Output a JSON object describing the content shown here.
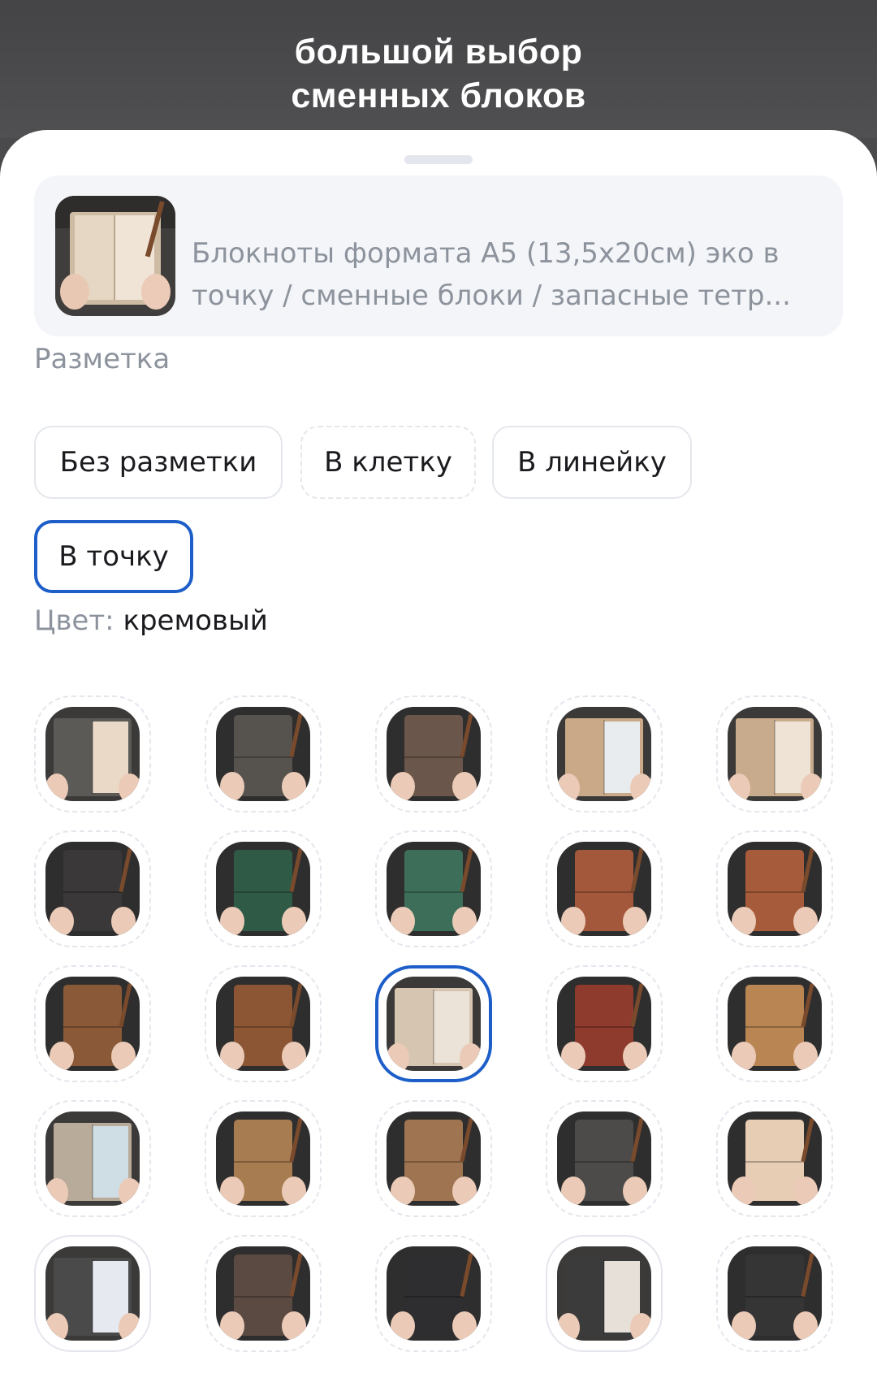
{
  "banner": {
    "line1": "большой выбор",
    "line2": "сменных блоков"
  },
  "product": {
    "title": "Блокноты формата А5 (13,5х20см) эко в точку / сменные блоки / запасные тетр..."
  },
  "markup": {
    "label": "Разметка",
    "options": [
      {
        "label": "Без разметки",
        "state": "available"
      },
      {
        "label": "В клетку",
        "state": "unavailable"
      },
      {
        "label": "В линейку",
        "state": "available"
      },
      {
        "label": "В точку",
        "state": "selected"
      }
    ]
  },
  "color": {
    "label": "Цвет:",
    "value": "кремовый",
    "swatches": [
      {
        "cover": "#5b5a57",
        "page": "#ead9c6",
        "style": "open",
        "border": "dashed"
      },
      {
        "cover": "#56534f",
        "page": null,
        "style": "closed",
        "border": "dashed"
      },
      {
        "cover": "#6a564a",
        "page": null,
        "style": "closed",
        "border": "dashed"
      },
      {
        "cover": "#c9a987",
        "page": "#e9ecef",
        "style": "open",
        "border": "dashed"
      },
      {
        "cover": "#c8aa8c",
        "page": "#efe3d6",
        "style": "open",
        "border": "dashed"
      },
      {
        "cover": "#3a3838",
        "page": null,
        "style": "closed",
        "border": "dashed"
      },
      {
        "cover": "#2f5a46",
        "page": null,
        "style": "closed",
        "border": "dashed"
      },
      {
        "cover": "#3d6e5a",
        "page": null,
        "style": "closed",
        "border": "dashed"
      },
      {
        "cover": "#a4583b",
        "page": null,
        "style": "closed",
        "border": "dashed"
      },
      {
        "cover": "#a65c3a",
        "page": null,
        "style": "closed",
        "border": "dashed"
      },
      {
        "cover": "#8a5a38",
        "page": null,
        "style": "closed",
        "border": "dashed"
      },
      {
        "cover": "#8c5634",
        "page": null,
        "style": "closed",
        "border": "dashed"
      },
      {
        "cover": "#d6c5b0",
        "page": "#ece3d8",
        "style": "open",
        "border": "selected"
      },
      {
        "cover": "#8e3a2c",
        "page": null,
        "style": "closed",
        "border": "dashed"
      },
      {
        "cover": "#b98552",
        "page": null,
        "style": "closed",
        "border": "dashed"
      },
      {
        "cover": "#b8ab9a",
        "page": "#cfdde4",
        "style": "open",
        "border": "dashed"
      },
      {
        "cover": "#a77c50",
        "page": null,
        "style": "closed",
        "border": "dashed"
      },
      {
        "cover": "#9e7550",
        "page": null,
        "style": "closed",
        "border": "dashed"
      },
      {
        "cover": "#4c4b4a",
        "page": null,
        "style": "closed",
        "border": "dashed"
      },
      {
        "cover": "#e6cdb4",
        "page": null,
        "style": "closed",
        "border": "dashed"
      },
      {
        "cover": "#4a4a4a",
        "page": "#e7e9f0",
        "style": "open",
        "border": "solid"
      },
      {
        "cover": "#5a4a42",
        "page": null,
        "style": "closed",
        "border": "dashed"
      },
      {
        "cover": "#2e2e30",
        "page": null,
        "style": "closed",
        "border": "dashed"
      },
      {
        "cover": "#3c3b3b",
        "page": "#e6e0d8",
        "style": "open",
        "border": "solid"
      },
      {
        "cover": "#353536",
        "page": null,
        "style": "closed",
        "border": "dashed"
      }
    ]
  }
}
